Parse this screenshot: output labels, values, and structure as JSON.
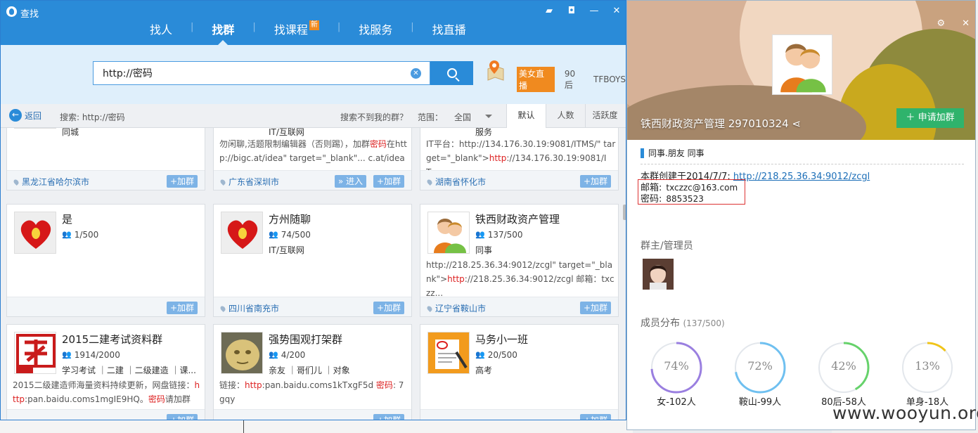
{
  "app": {
    "title": "查找"
  },
  "nav": {
    "tabs": [
      {
        "label": "找人"
      },
      {
        "label": "找群"
      },
      {
        "label": "找课程",
        "badge": "新"
      },
      {
        "label": "找服务"
      },
      {
        "label": "找直播"
      }
    ]
  },
  "search": {
    "value": "http://密码"
  },
  "hot": {
    "live": "美女直播",
    "t1": "90后",
    "t2": "TFBOYS"
  },
  "filter": {
    "back": "返回",
    "query": "搜索: http://密码",
    "cant_find": "搜索不到我的群？",
    "scope_label": "范围：",
    "scope_value": "全国",
    "sort": [
      "默认",
      "人数",
      "活跃度"
    ]
  },
  "cards": [
    {
      "tags": "同城",
      "location": "黑龙江省哈尔滨市",
      "join": "+加群"
    },
    {
      "tags": "IT/互联网",
      "desc_parts": [
        "勿闲聊,活题限制编辑器（否则踢），加群",
        "密码",
        "在http://bigc.at/idea\" target=\"_blank\"... c.at/idea"
      ],
      "location": "广东省深圳市",
      "enter": "» 进入",
      "join": "+加群"
    },
    {
      "tags": "服务",
      "desc_parts": [
        "IT平台：http://134.176.30.19:9081/ITMS/\" target=\"_blank\">",
        "http",
        "://134.176.30.19:9081/IT..."
      ],
      "location": "湖南省怀化市",
      "join": "+加群"
    },
    {
      "name": "是",
      "members": "1/500",
      "join": "+加群"
    },
    {
      "name": "方州随聊",
      "members": "74/500",
      "tags": "IT/互联网",
      "location": "四川省南充市",
      "join": "+加群"
    },
    {
      "name": "铁西财政资产管理",
      "members": "137/500",
      "tags": "同事",
      "desc_parts": [
        "http://218.25.36.34:9012/zcgl\" target=\"_blank\">",
        "http",
        "://218.25.36.34:9012/zcgl 邮箱：txczz..."
      ],
      "location": "辽宁省鞍山市",
      "join": "+加群"
    },
    {
      "name": "2015二建考试资料群",
      "members": "1914/2000",
      "tags": "学习考试 ｜二建 ｜二级建造 ｜课...",
      "desc_parts": [
        "2015二级建造师海量资料持续更新，网盘链接：",
        "http",
        ":pan.baidu.coms1mgIE9HQ。",
        "密码",
        "请加群见..."
      ],
      "join": "+加群"
    },
    {
      "name": "强势围观打架群",
      "members": "4/200",
      "tags": "亲友 ｜哥们儿 ｜对象",
      "desc_parts": [
        "链接：",
        "http",
        ":pan.baidu.coms1kTxgF5d ",
        "密码",
        ": 7gqy"
      ],
      "join": "+加群"
    },
    {
      "name": "马务小一班",
      "members": "20/500",
      "tags": "高考",
      "join": "+加群"
    }
  ],
  "profile": {
    "name": "铁西财政资产管理 297010324",
    "apply": "申请加群",
    "category": "同事.朋友  同事",
    "created_prefix": "本群创建于2014/7/7: ",
    "created_link": "http://218.25.36.34:9012/zcgl",
    "mail_label": "邮箱:",
    "mail_value": "txczzc@163.com",
    "pwd_label": "密码:",
    "pwd_value": "8853523",
    "admins_title": "群主/管理员",
    "dist_title": "成员分布",
    "dist_count": "(137/500)",
    "dist": [
      {
        "value": "74%",
        "label": "女-102人",
        "pct": 74,
        "color": "#9a7fe0"
      },
      {
        "value": "72%",
        "label": "鞍山-99人",
        "pct": 72,
        "color": "#6fc0f0"
      },
      {
        "value": "42%",
        "label": "80后-58人",
        "pct": 42,
        "color": "#66d26b"
      },
      {
        "value": "13%",
        "label": "单身-18人",
        "pct": 13,
        "color": "#f0c419"
      }
    ]
  },
  "watermark": "www.wooyun.org"
}
